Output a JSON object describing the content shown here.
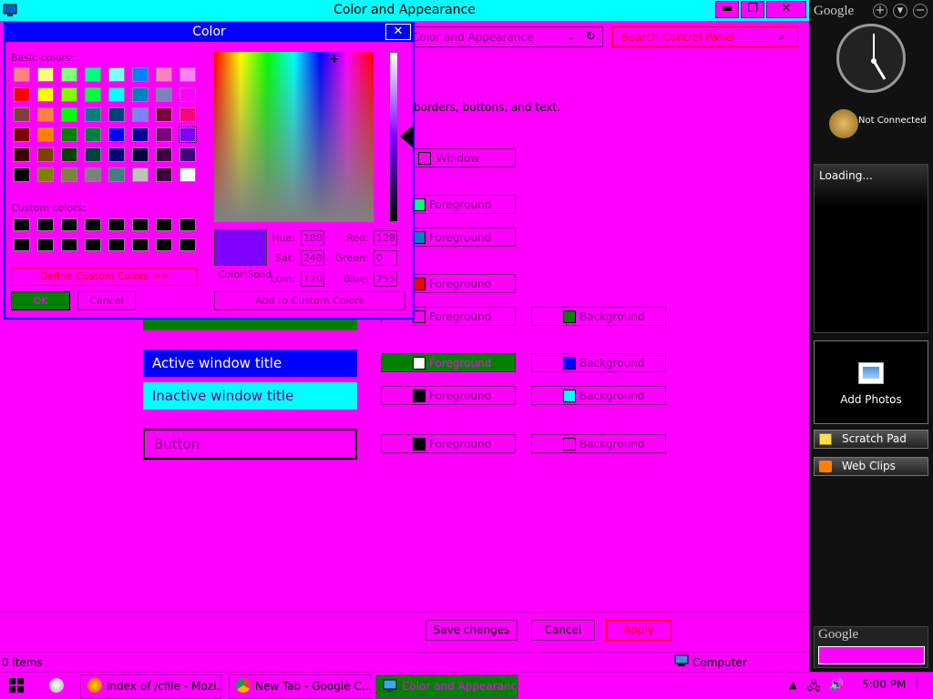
{
  "window": {
    "title": "Color and Appearance",
    "minimize": "▬",
    "restore": "❐",
    "close": "✕",
    "address": "Color and Appearance",
    "search_placeholder": "Search Control Panel",
    "description": "borders, buttons, and text."
  },
  "items": {
    "window_label": "Window",
    "fg1": "Foreground",
    "fg2": "Foreground",
    "fg3": "Foreground",
    "sel_fg": "Foreground",
    "sel_bg": "Background",
    "active_preview": "Active window title",
    "active_fg": "Foreground",
    "active_bg": "Background",
    "inactive_preview": "Inactive window title",
    "inactive_fg": "Foreground",
    "inactive_bg": "Background",
    "button_preview": "Button",
    "button_fg": "Foreground",
    "button_bg": "Background"
  },
  "footer": {
    "save": "Save changes",
    "cancel": "Cancel",
    "apply": "Apply"
  },
  "status": {
    "items": "0 items",
    "computer": "Computer"
  },
  "dialog": {
    "title": "Color",
    "close": "✕",
    "basic_colors_label": "Basic colors:",
    "custom_colors_label": "Custom colors:",
    "define_custom": "Define Custom Colors >>",
    "ok": "OK",
    "cancel": "Cancel",
    "color_solid": "Color|Solid",
    "add_custom": "Add to Custom Colors",
    "hue_label": "Hue:",
    "hue": "180",
    "sat_label": "Sat:",
    "sat": "240",
    "lum_label": "Lum:",
    "lum": "120",
    "red_label": "Red:",
    "red": "128",
    "green_label": "Green:",
    "green": "0",
    "blue_label": "Blue:",
    "blue": "255",
    "basic_colors": [
      "#ff8080",
      "#ffff80",
      "#80ff80",
      "#00ff80",
      "#80ffff",
      "#0080ff",
      "#ff80c0",
      "#ff80ff",
      "#ff0000",
      "#ffff00",
      "#80ff00",
      "#00ff40",
      "#00ffff",
      "#0080c0",
      "#8080c0",
      "#ff00ff",
      "#804040",
      "#ff8040",
      "#00ff00",
      "#008080",
      "#004080",
      "#8080ff",
      "#800040",
      "#ff0080",
      "#800000",
      "#ff8000",
      "#008000",
      "#008040",
      "#0000ff",
      "#0000a0",
      "#800080",
      "#8000ff",
      "#400000",
      "#804000",
      "#004000",
      "#004040",
      "#000080",
      "#000040",
      "#400040",
      "#400080",
      "#000000",
      "#808000",
      "#808040",
      "#808080",
      "#408080",
      "#c0c0c0",
      "#400040",
      "#ffffff"
    ]
  },
  "taskbar": {
    "task1": "Index of /cfile - Mozi...",
    "task2": "New Tab - Google C...",
    "task3": "Color and Appearance",
    "time": "5:00 PM"
  },
  "sidebar": {
    "logo": "Google",
    "not_connected": "Not Connected",
    "loading": "Loading...",
    "add_photos": "Add Photos",
    "scratch_pad": "Scratch Pad",
    "web_clips": "Web Clips",
    "bottom_logo": "Google"
  },
  "colors": {
    "accent": "#ff00ff",
    "title_cyan": "#00ffff",
    "dialog_blue": "#0000ff",
    "ok_green": "#008000"
  }
}
